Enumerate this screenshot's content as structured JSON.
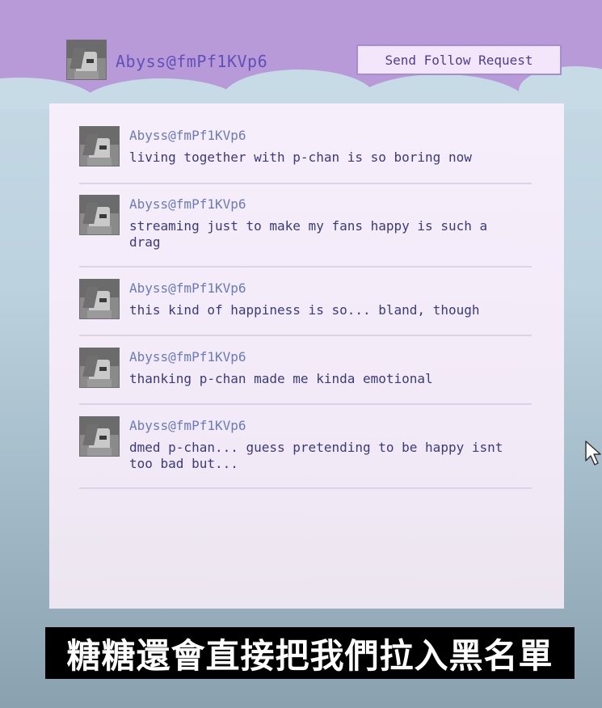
{
  "colors": {
    "header_purple": "#b89ad9",
    "cloud_blue": "#c6dbe5",
    "panel_pink": "#f4ebf9",
    "handle_purple": "#6150b8",
    "post_name_blue": "#6a7ac0",
    "post_text": "#3b3a7d"
  },
  "profile": {
    "handle": "Abyss@fmPf1KVp6",
    "follow_button_label": "Send Follow Request"
  },
  "posts": [
    {
      "author": "Abyss@fmPf1KVp6",
      "text": "living together with p-chan is so boring now"
    },
    {
      "author": "Abyss@fmPf1KVp6",
      "text": "streaming just to make my fans happy is such a\ndrag"
    },
    {
      "author": "Abyss@fmPf1KVp6",
      "text": "this kind of happiness is so... bland, though"
    },
    {
      "author": "Abyss@fmPf1KVp6",
      "text": "thanking p-chan made me kinda emotional"
    },
    {
      "author": "Abyss@fmPf1KVp6",
      "text": "dmed p-chan... guess pretending to be happy isnt\ntoo bad but..."
    }
  ],
  "icons": {
    "avatar": "avatar-icon",
    "cursor": "mouse-pointer-icon"
  },
  "subtitle": "糖糖還會直接把我們拉入黑名單"
}
